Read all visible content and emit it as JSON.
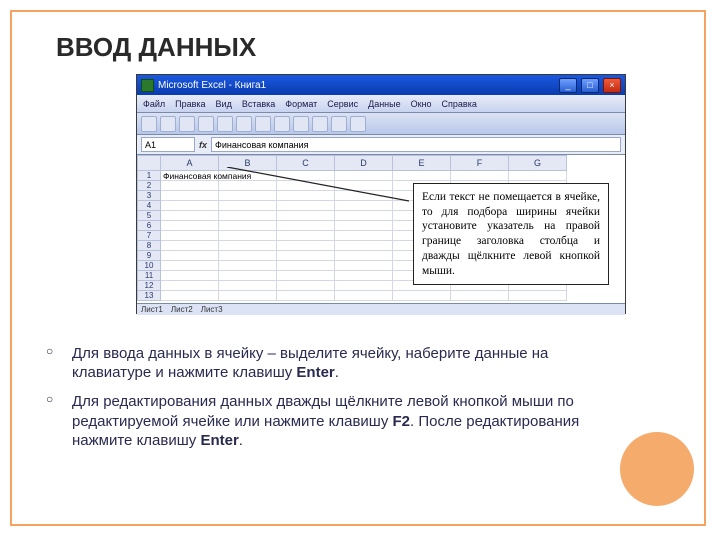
{
  "title": "ВВОД ДАННЫХ",
  "excel": {
    "app_title": "Microsoft Excel - Книга1",
    "menu": [
      "Файл",
      "Правка",
      "Вид",
      "Вставка",
      "Формат",
      "Сервис",
      "Данные",
      "Окно",
      "Справка"
    ],
    "namebox": "A1",
    "formula": "Финансовая компания",
    "columns": [
      "A",
      "B",
      "C",
      "D",
      "E",
      "F",
      "G"
    ],
    "rows": [
      "1",
      "2",
      "3",
      "4",
      "5",
      "6",
      "7",
      "8",
      "9",
      "10",
      "11",
      "12",
      "13"
    ],
    "cell_a1": "Финансовая компания",
    "sheets": [
      "Лист1",
      "Лист2",
      "Лист3"
    ]
  },
  "callout_text": "Если текст не помещается в ячейке, то для подбора ширины ячейки установите указатель на правой границе заголовка столбца и дважды щёлкните левой кнопкой мыши.",
  "bullets": [
    {
      "pre": "Для ввода данных в ячейку – выделите ячейку, наберите данные на клавиатуре и нажмите клавишу ",
      "key": "Enter",
      "post": "."
    },
    {
      "pre": "Для редактирования данных дважды щёлкните левой кнопкой мыши по редактируемой ячейке или нажмите клавишу ",
      "key": "F2",
      "mid": ". После редактирования нажмите клавишу ",
      "key2": "Enter",
      "post": "."
    }
  ],
  "winbuttons": {
    "min": "_",
    "max": "□",
    "close": "×"
  }
}
